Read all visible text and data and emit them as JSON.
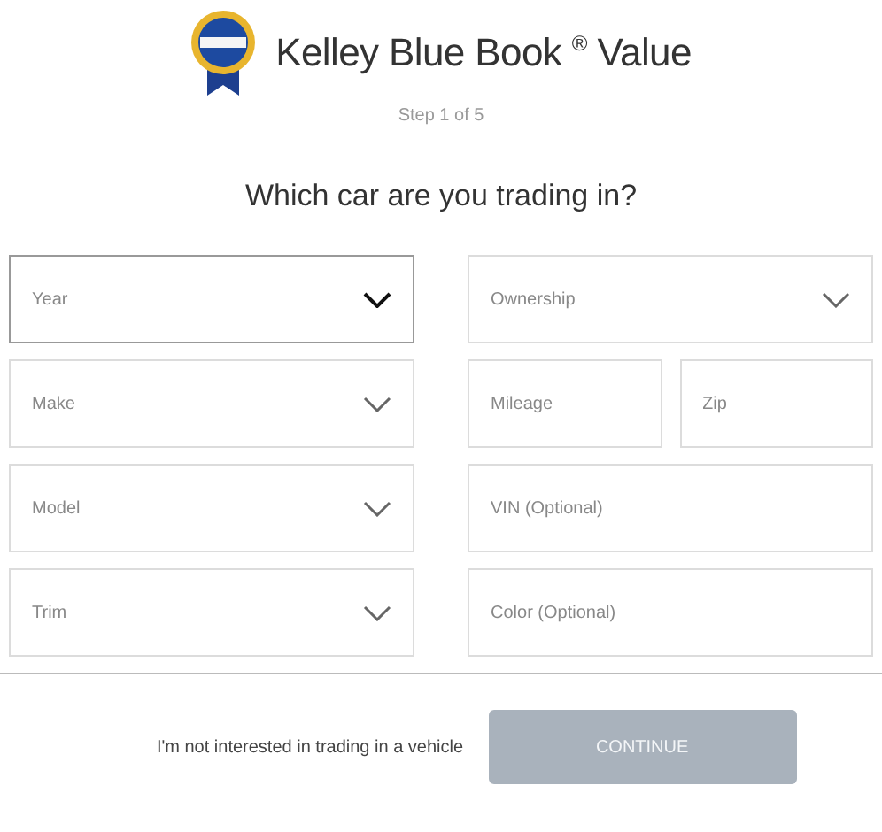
{
  "header": {
    "title": "Kelley Blue Book $^{®}$ Value",
    "step": "Step 1 of 5"
  },
  "question": "Which car are you trading in?",
  "form_rows": [
    {
      "left": [
        {
          "kind": "select",
          "label": "Year",
          "focused": true
        }
      ],
      "right": [
        {
          "kind": "select",
          "label": "Ownership",
          "focused": false
        }
      ]
    },
    {
      "left": [
        {
          "kind": "select",
          "label": "Make",
          "focused": false
        }
      ],
      "right": [
        {
          "kind": "text",
          "placeholder": "Mileage",
          "focused": false
        },
        {
          "kind": "text",
          "placeholder": "Zip",
          "focused": false
        }
      ]
    },
    {
      "left": [
        {
          "kind": "select",
          "label": "Model",
          "focused": false
        }
      ],
      "right": [
        {
          "kind": "text",
          "placeholder": "VIN (Optional)",
          "focused": false
        }
      ]
    },
    {
      "left": [
        {
          "kind": "select",
          "label": "Trim",
          "focused": false
        }
      ],
      "right": [
        {
          "kind": "text",
          "placeholder": "Color (Optional)",
          "focused": false
        }
      ]
    }
  ],
  "footer": {
    "link": "I'm not interested in trading in a vehicle",
    "button": {
      "label": "CONTINUE",
      "disabled": true
    }
  }
}
